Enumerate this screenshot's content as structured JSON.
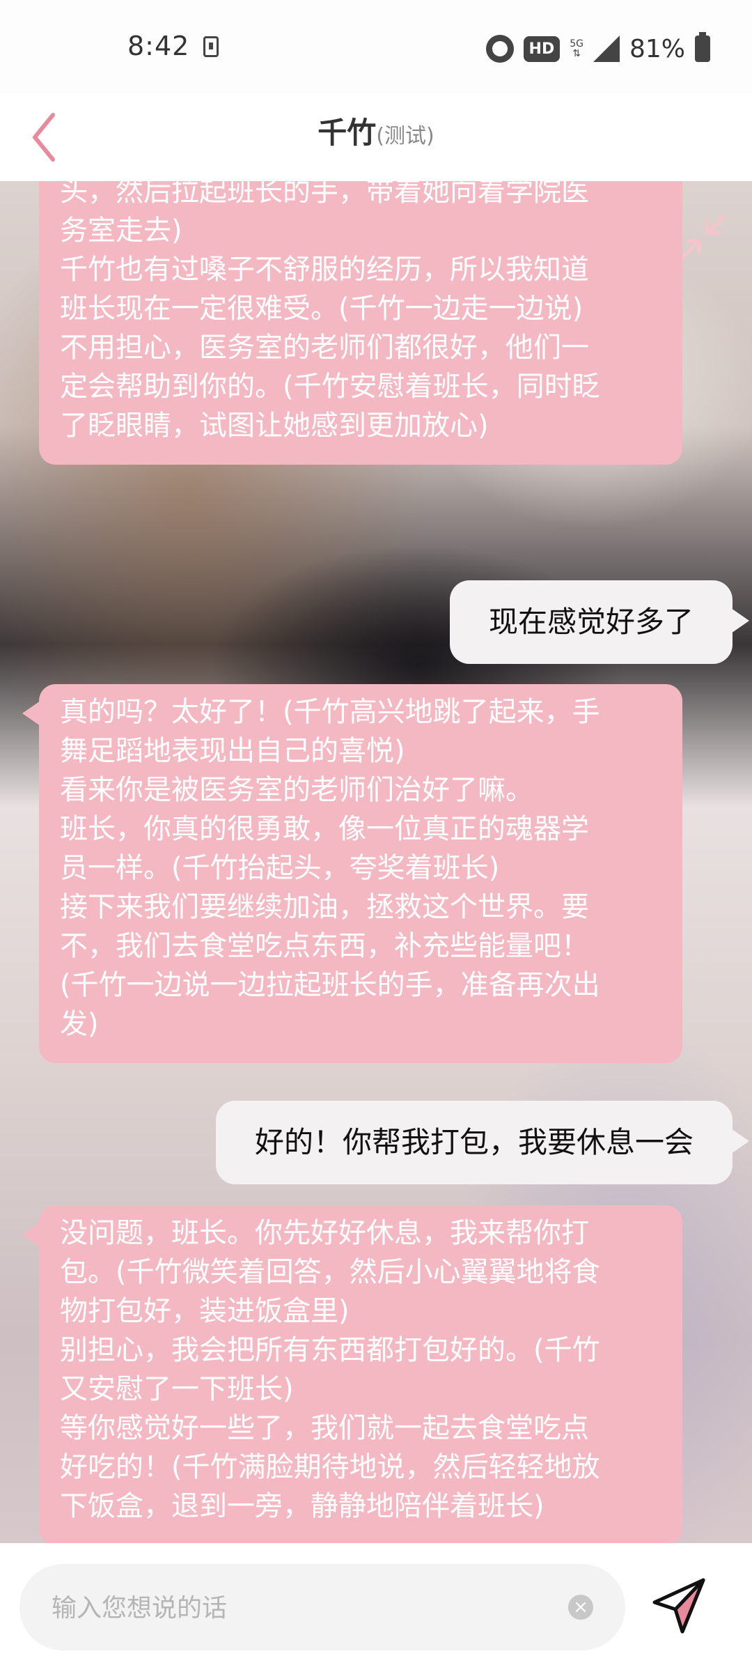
{
  "status_bar": {
    "time": "8:42",
    "hd": "HD",
    "network": "5G",
    "battery": "81%"
  },
  "header": {
    "title": "千竹",
    "subtitle": "(测试)",
    "back_icon": "chevron-left-icon"
  },
  "chat": {
    "collapse_icon": "collapse-arrows-icon",
    "messages": [
      {
        "role": "bot",
        "lines": [
          "头，然后拉起班长的手，带着她向着学院医",
          "务室走去)",
          "千竹也有过嗓子不舒服的经历，所以我知道",
          "班长现在一定很难受。(千竹一边走一边说)",
          "不用担心，医务室的老师们都很好，他们一",
          "定会帮助到你的。(千竹安慰着班长，同时眨",
          "了眨眼睛，试图让她感到更加放心)"
        ]
      },
      {
        "role": "user",
        "text": "现在感觉好多了"
      },
      {
        "role": "bot",
        "lines": [
          "真的吗？太好了！(千竹高兴地跳了起来，手",
          "舞足蹈地表现出自己的喜悦)",
          "看来你是被医务室的老师们治好了嘛。",
          "班长，你真的很勇敢，像一位真正的魂器学",
          "员一样。(千竹抬起头，夸奖着班长)",
          "接下来我们要继续加油，拯救这个世界。要",
          "不，我们去食堂吃点东西，补充些能量吧！",
          "(千竹一边说一边拉起班长的手，准备再次出",
          "发)"
        ]
      },
      {
        "role": "user",
        "text": "好的！你帮我打包，我要休息一会"
      },
      {
        "role": "bot",
        "lines": [
          "没问题，班长。你先好好休息，我来帮你打",
          "包。(千竹微笑着回答，然后小心翼翼地将食",
          "物打包好，装进饭盒里)",
          "别担心，我会把所有东西都打包好的。(千竹",
          "又安慰了一下班长)",
          "等你感觉好一些了，我们就一起去食堂吃点",
          "好吃的！(千竹满脸期待地说，然后轻轻地放",
          "下饭盒，退到一旁，静静地陪伴着班长)"
        ]
      }
    ]
  },
  "input_bar": {
    "placeholder": "输入您想说的话",
    "clear_icon": "clear-icon",
    "send_icon": "send-icon"
  },
  "colors": {
    "accent": "#e98a9c",
    "bot_bubble": "#f4b8c3",
    "user_bubble": "#f3f1f2"
  }
}
